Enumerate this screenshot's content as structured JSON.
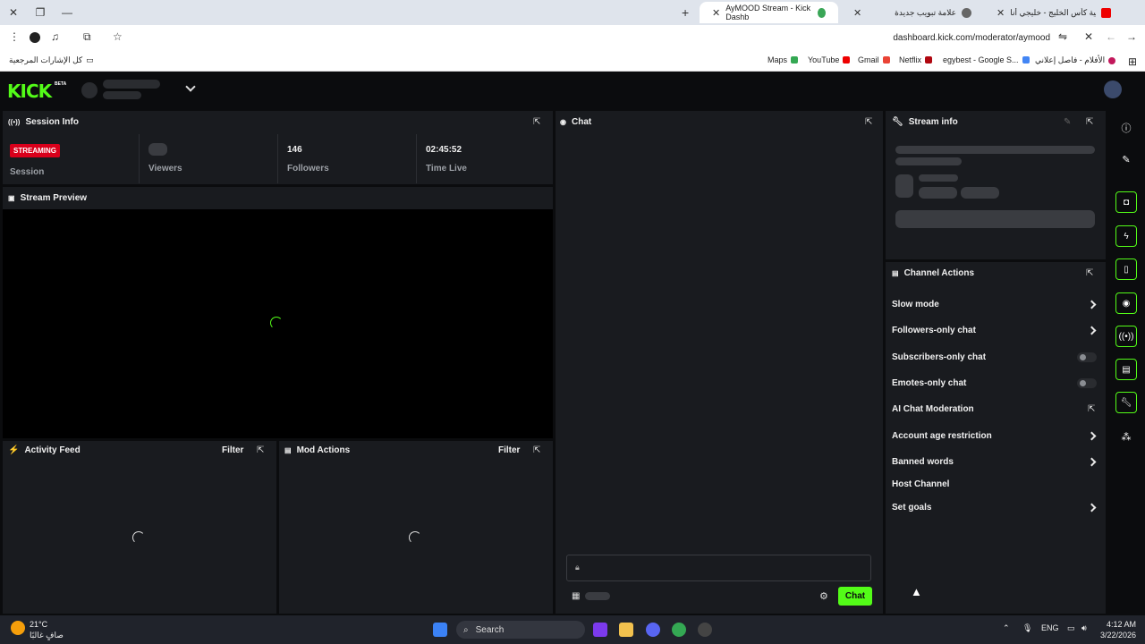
{
  "browser": {
    "tabs": [
      {
        "title": "AyMOOD Stream - Kick Dashb",
        "active": true
      },
      {
        "title": "علامة تبويب جديدة",
        "active": false
      },
      {
        "title": "أغنية كأس الخليج - خليجي أنا | ee",
        "active": false
      }
    ],
    "url": "dashboard.kick.com/moderator/aymood",
    "bookmarks": {
      "all_label": "كل الإشارات المرجعية",
      "items": [
        "Maps",
        "YouTube",
        "Gmail",
        "Netflix",
        "egybest - Google S...",
        "الأفلام - فاصل إعلاني"
      ]
    }
  },
  "kick": {
    "logo": "KICK",
    "beta": "BETA",
    "session_info": {
      "title": "Session Info",
      "badge": "STREAMING",
      "session_label": "Session",
      "viewers_label": "Viewers",
      "followers_value": "146",
      "followers_label": "Followers",
      "time_value": "02:45:52",
      "time_label": "Time Live"
    },
    "stream_preview": {
      "title": "Stream Preview"
    },
    "activity_feed": {
      "title": "Activity Feed",
      "filter": "Filter"
    },
    "mod_actions": {
      "title": "Mod Actions",
      "filter": "Filter"
    },
    "chat": {
      "title": "Chat",
      "send_label": "Chat"
    },
    "stream_info": {
      "title": "Stream info"
    },
    "channel_actions": {
      "title": "Channel Actions",
      "items": [
        {
          "label": "Slow mode",
          "control": "chevron"
        },
        {
          "label": "Followers-only chat",
          "control": "chevron"
        },
        {
          "label": "Subscribers-only chat",
          "control": "toggle"
        },
        {
          "label": "Emotes-only chat",
          "control": "toggle"
        },
        {
          "label": "AI Chat Moderation",
          "control": "external"
        },
        {
          "label": "Account age restriction",
          "control": "chevron"
        },
        {
          "label": "Banned words",
          "control": "chevron"
        },
        {
          "label": "Host Channel",
          "control": "none"
        },
        {
          "label": "Set goals",
          "control": "chevron"
        }
      ]
    }
  },
  "taskbar": {
    "weather_temp": "21°C",
    "weather_desc": "صافٍ غالبًا",
    "search_placeholder": "Search",
    "lang": "ENG",
    "time": "4:12 AM",
    "date": "3/22/2026"
  },
  "colors": {
    "accent": "#53fc18",
    "live": "#d9001b",
    "panel": "#191b1f",
    "bg": "#0b0c0e"
  }
}
